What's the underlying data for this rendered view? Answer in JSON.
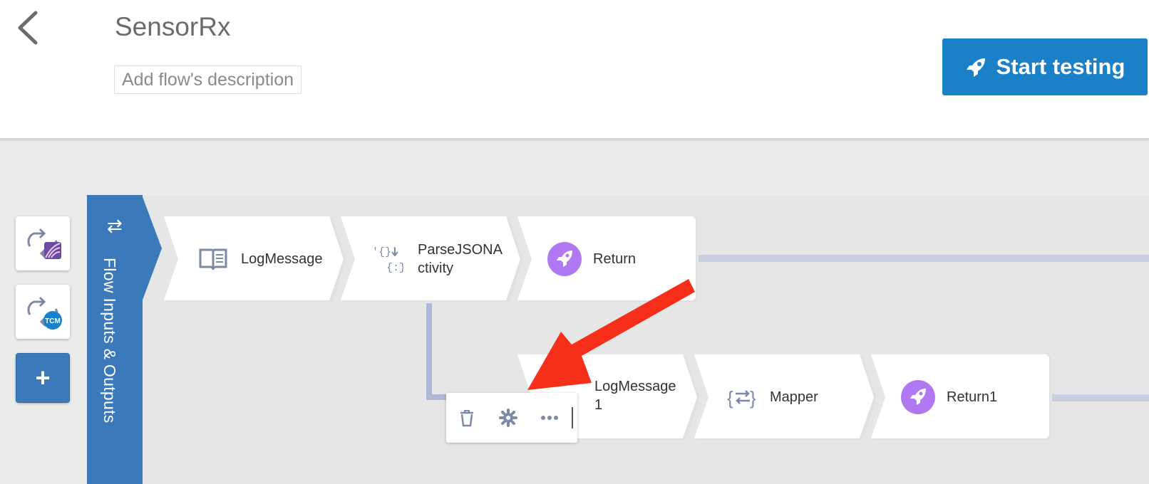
{
  "header": {
    "title": "SensorRx",
    "description_placeholder": "Add flow's description",
    "start_button_label": "Start testing"
  },
  "sidebar": {
    "triggers": [
      {
        "name": "flogo-trigger"
      },
      {
        "name": "tcm-trigger",
        "badge": "TCM"
      }
    ],
    "add_label": "+"
  },
  "flow_io": {
    "label": "Flow Inputs & Outputs",
    "icon": "⇄"
  },
  "main_branch": {
    "tiles": [
      {
        "label": "LogMessage",
        "icon": "book-icon"
      },
      {
        "label": "ParseJSONA\nctivity",
        "icon": "json-parse-icon"
      },
      {
        "label": "Return",
        "icon": "rocket-icon"
      }
    ]
  },
  "sub_branch": {
    "tiles": [
      {
        "label": "LogMessage\n1",
        "icon": "book-icon"
      },
      {
        "label": "Mapper",
        "icon": "mapper-icon"
      },
      {
        "label": "Return1",
        "icon": "rocket-icon"
      }
    ],
    "toolbar": [
      "trash-icon",
      "gear-icon",
      "more-icon"
    ]
  },
  "colors": {
    "accent_blue": "#1a80c8",
    "panel_blue": "#3b79ba",
    "rocket_purple": "#b179f1",
    "callout_red": "#f62f1b"
  }
}
